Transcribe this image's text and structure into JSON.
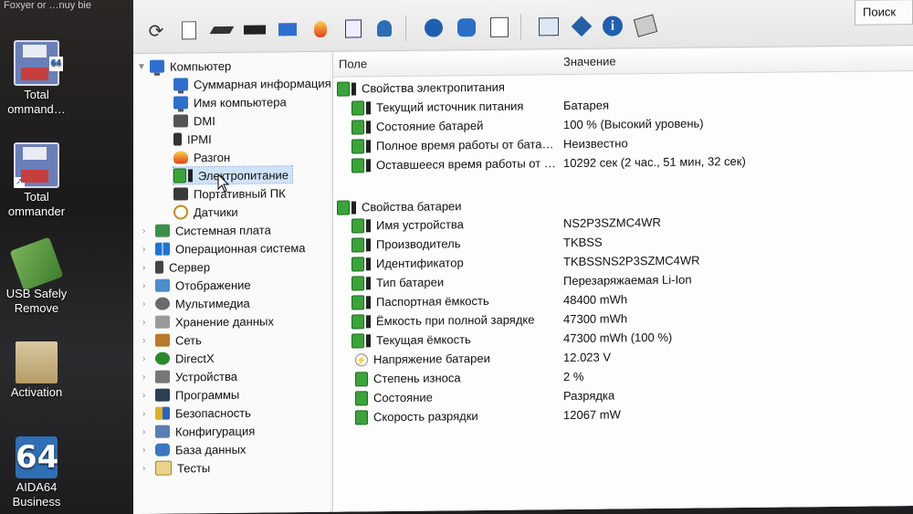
{
  "desktop": {
    "top_text": "Foxyer or   …nuy bie",
    "icons": [
      {
        "label_line1": "Total",
        "label_line2": "ommand…",
        "badge": "64"
      },
      {
        "label_line1": "Total",
        "label_line2": "ommander"
      },
      {
        "label_line1": "USB Safely",
        "label_line2": "Remove"
      },
      {
        "label_line1": "Activation",
        "label_line2": ""
      },
      {
        "label_line1": "AIDA64",
        "label_line2": "Business",
        "badge": "64"
      }
    ]
  },
  "toolbar": {
    "search_label": "Поиск"
  },
  "tree": {
    "root": "Компьютер",
    "children": [
      "Суммарная информация",
      "Имя компьютера",
      "DMI",
      "IPMI",
      "Разгон",
      "Электропитание",
      "Портативный ПК",
      "Датчики"
    ],
    "categories": [
      "Системная плата",
      "Операционная система",
      "Сервер",
      "Отображение",
      "Мультимедиа",
      "Хранение данных",
      "Сеть",
      "DirectX",
      "Устройства",
      "Программы",
      "Безопасность",
      "Конфигурация",
      "База данных",
      "Тесты"
    ]
  },
  "list": {
    "col_field": "Поле",
    "col_value": "Значение",
    "group1": "Свойства электропитания",
    "group1_rows": [
      {
        "field": "Текущий источник питания",
        "value": "Батарея"
      },
      {
        "field": "Состояние батарей",
        "value": "100 % (Высокий уровень)"
      },
      {
        "field": "Полное время работы от бата…",
        "value": "Неизвестно"
      },
      {
        "field": "Оставшееся время работы от …",
        "value": "10292 сек (2 час., 51 мин, 32 сек)"
      }
    ],
    "group2": "Свойства батареи",
    "group2_rows": [
      {
        "field": "Имя устройства",
        "value": "NS2P3SZMC4WR"
      },
      {
        "field": "Производитель",
        "value": "TKBSS"
      },
      {
        "field": "Идентификатор",
        "value": "TKBSSNS2P3SZMC4WR"
      },
      {
        "field": "Тип батареи",
        "value": "Перезаряжаемая Li-Ion"
      },
      {
        "field": "Паспортная ёмкость",
        "value": "48400 mWh"
      },
      {
        "field": "Ёмкость при полной зарядке",
        "value": "47300 mWh"
      },
      {
        "field": "Текущая ёмкость",
        "value": "47300 mWh  (100 %)"
      },
      {
        "field": "Напряжение батареи",
        "value": "12.023 V"
      },
      {
        "field": "Степень износа",
        "value": "2 %"
      },
      {
        "field": "Состояние",
        "value": "Разрядка"
      },
      {
        "field": "Скорость разрядки",
        "value": "12067 mW"
      }
    ]
  }
}
